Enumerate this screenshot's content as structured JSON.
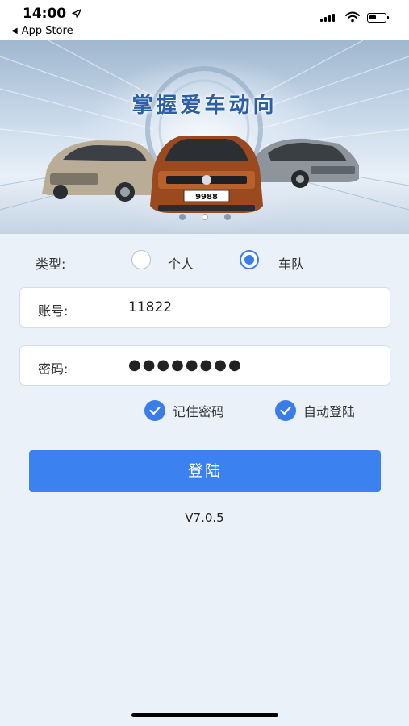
{
  "status_bar": {
    "time": "14:00",
    "back_app": "App Store",
    "icons": [
      "location-arrow-icon",
      "signal-icon",
      "wifi-icon",
      "battery-icon"
    ]
  },
  "banner": {
    "title": "掌握爱车动向",
    "car_plate": "9988",
    "slide_count": 3,
    "active_slide": 2
  },
  "form": {
    "type_label": "类型:",
    "type_options": [
      {
        "label": "个人",
        "checked": false
      },
      {
        "label": "车队",
        "checked": true
      }
    ],
    "account_label": "账号:",
    "account_value": "11822",
    "password_label": "密码:",
    "password_value": "●●●●●●●●",
    "remember_password": {
      "label": "记住密码",
      "checked": true
    },
    "auto_login": {
      "label": "自动登陆",
      "checked": true
    }
  },
  "login_button": "登陆",
  "version": "V7.0.5",
  "colors": {
    "accent": "#3b82f0",
    "background": "#eaf1f8",
    "banner_title": "#2c5fa8"
  }
}
